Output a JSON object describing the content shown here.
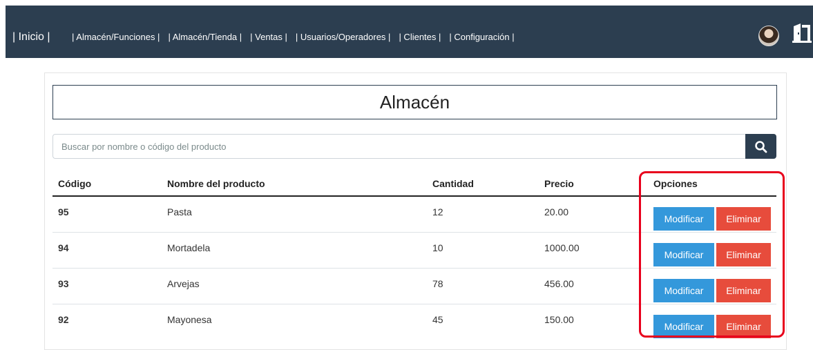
{
  "nav": {
    "home": "| Inicio |",
    "links": [
      "| Almacén/Funciones |",
      "| Almacén/Tienda |",
      "| Ventas |",
      "| Usuarios/Operadores |",
      "| Clientes |",
      "| Configuración |"
    ],
    "avatar_icon": "user-avatar",
    "exit_icon": "door-exit-icon"
  },
  "page": {
    "title": "Almacén"
  },
  "search": {
    "placeholder": "Buscar por nombre o código del producto",
    "value": "",
    "icon": "search-icon"
  },
  "table": {
    "headers": [
      "Código",
      "Nombre del producto",
      "Cantidad",
      "Precio",
      "Opciones"
    ],
    "rows": [
      {
        "code": "95",
        "name": "Pasta",
        "quantity": "12",
        "price": "20.00"
      },
      {
        "code": "94",
        "name": "Mortadela",
        "quantity": "10",
        "price": "1000.00"
      },
      {
        "code": "93",
        "name": "Arvejas",
        "quantity": "78",
        "price": "456.00"
      },
      {
        "code": "92",
        "name": "Mayonesa",
        "quantity": "45",
        "price": "150.00"
      }
    ],
    "modify_label": "Modificar",
    "delete_label": "Eliminar"
  },
  "colors": {
    "navbar": "#2c3e50",
    "modify": "#3498db",
    "delete": "#e74c3c",
    "highlight": "#e8001c"
  }
}
